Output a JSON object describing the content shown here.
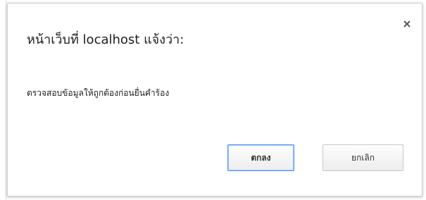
{
  "dialog": {
    "title": "หน้าเว็บที่ localhost แจ้งว่า:",
    "message": "ตรวจสอบข้อมูลให้ถูกต้องก่อนยื่นคำร้อง",
    "close_icon": "close-icon",
    "ok_label": "ตกลง",
    "cancel_label": "ยกเลิก"
  },
  "colors": {
    "ok_border": "#4d90fe",
    "dialog_border": "#cfcfcf",
    "text": "#202020"
  }
}
